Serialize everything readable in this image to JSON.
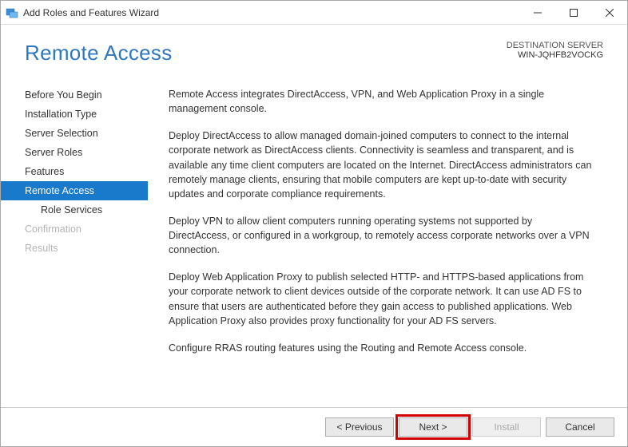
{
  "window": {
    "title": "Add Roles and Features Wizard"
  },
  "header": {
    "page_title": "Remote Access",
    "destination_label": "DESTINATION SERVER",
    "destination_server": "WIN-JQHFB2VOCKG"
  },
  "sidebar": {
    "items": [
      {
        "label": "Before You Begin",
        "selected": false,
        "sub": false,
        "disabled": false
      },
      {
        "label": "Installation Type",
        "selected": false,
        "sub": false,
        "disabled": false
      },
      {
        "label": "Server Selection",
        "selected": false,
        "sub": false,
        "disabled": false
      },
      {
        "label": "Server Roles",
        "selected": false,
        "sub": false,
        "disabled": false
      },
      {
        "label": "Features",
        "selected": false,
        "sub": false,
        "disabled": false
      },
      {
        "label": "Remote Access",
        "selected": true,
        "sub": false,
        "disabled": false
      },
      {
        "label": "Role Services",
        "selected": false,
        "sub": true,
        "disabled": false
      },
      {
        "label": "Confirmation",
        "selected": false,
        "sub": false,
        "disabled": true
      },
      {
        "label": "Results",
        "selected": false,
        "sub": false,
        "disabled": true
      }
    ]
  },
  "main": {
    "paragraphs": [
      "Remote Access integrates DirectAccess, VPN, and Web Application Proxy in a single management console.",
      "Deploy DirectAccess to allow managed domain-joined computers to connect to the internal corporate network as DirectAccess clients. Connectivity is seamless and transparent, and is available any time client computers are located on the Internet. DirectAccess administrators can remotely manage clients, ensuring that mobile computers are kept up-to-date with security updates and corporate compliance requirements.",
      "Deploy VPN to allow client computers running operating systems not supported by DirectAccess, or configured in a workgroup, to remotely access corporate networks over a VPN connection.",
      "Deploy Web Application Proxy to publish selected HTTP- and HTTPS-based applications from your corporate network to client devices outside of the corporate network. It can use AD FS to ensure that users are authenticated before they gain access to published applications. Web Application Proxy also provides proxy functionality for your AD FS servers.",
      "Configure RRAS routing features using the Routing and Remote Access console."
    ]
  },
  "footer": {
    "previous": "< Previous",
    "next": "Next >",
    "install": "Install",
    "cancel": "Cancel"
  }
}
